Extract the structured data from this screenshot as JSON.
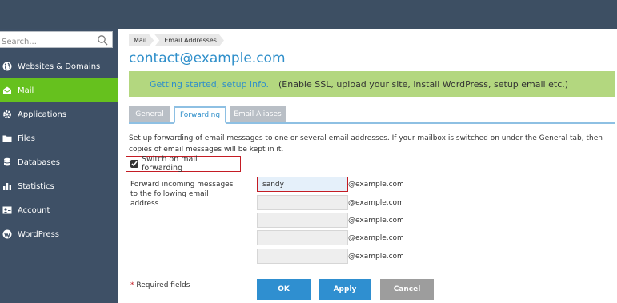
{
  "search": {
    "placeholder": "Search..."
  },
  "sidebar": {
    "items": [
      {
        "label": "Websites & Domains",
        "icon": "globe-icon",
        "active": false
      },
      {
        "label": "Mail",
        "icon": "mail-icon",
        "active": true
      },
      {
        "label": "Applications",
        "icon": "gear-icon",
        "active": false
      },
      {
        "label": "Files",
        "icon": "folder-icon",
        "active": false
      },
      {
        "label": "Databases",
        "icon": "database-icon",
        "active": false
      },
      {
        "label": "Statistics",
        "icon": "bar-chart-icon",
        "active": false
      },
      {
        "label": "Account",
        "icon": "account-icon",
        "active": false
      },
      {
        "label": "WordPress",
        "icon": "wordpress-icon",
        "active": false
      }
    ]
  },
  "breadcrumb": {
    "items": [
      "Mail",
      "Email Addresses"
    ]
  },
  "page": {
    "title": "contact@example.com"
  },
  "banner": {
    "link": "Getting started, setup info.",
    "text": "(Enable SSL, upload your site, install WordPress, setup email etc.)"
  },
  "tabs": [
    {
      "label": "General",
      "active": false
    },
    {
      "label": "Forwarding",
      "active": true
    },
    {
      "label": "Email Aliases",
      "active": false
    }
  ],
  "forwarding": {
    "description": "Set up forwarding of email messages to one or several email addresses. If your mailbox is switched on under the General tab, then copies of email messages will be kept in it.",
    "checkbox_label": "Switch on mail forwarding",
    "checkbox_checked": true,
    "field_label": "Forward incoming messages to the following email address",
    "domain_suffix": "@example.com",
    "addresses": [
      "sandy",
      "",
      "",
      "",
      ""
    ]
  },
  "footer": {
    "required_star": "*",
    "required_text": "Required fields",
    "ok_label": "OK",
    "apply_label": "Apply",
    "cancel_label": "Cancel"
  },
  "colors": {
    "header_bg": "#3d4f63",
    "sidebar_bg": "#3e5066",
    "active_green": "#66c11e",
    "title_blue": "#2f8fca",
    "banner_green": "#b3d77f",
    "button_blue": "#2f8fd0",
    "highlight_red": "#c41c24"
  }
}
